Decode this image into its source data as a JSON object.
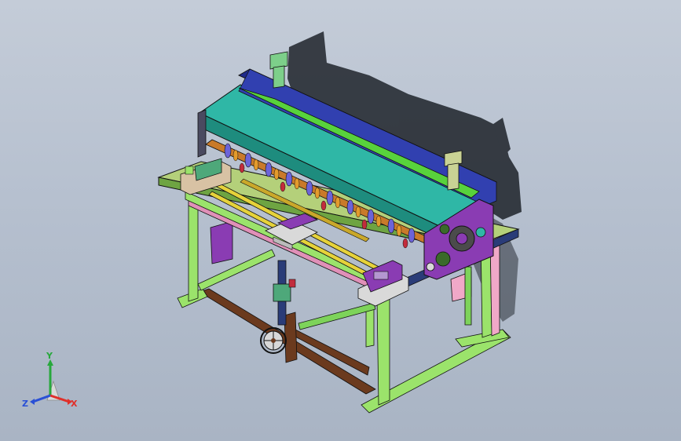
{
  "viewport": {
    "background_top": "#c4ccd8",
    "background_bottom": "#a9b4c4"
  },
  "model": {
    "subject": "slitting-machine-assembly",
    "colors": {
      "frame_leg": "#9be36b",
      "frame_leg_alt": "#f0a8c8",
      "base_beam": "#6b3a1e",
      "top_cover": "#2fb7a6",
      "side_plate": "#8a3cb3",
      "top_rail": "#1f2a8c",
      "guide_bar": "#e6d23a",
      "tray": "#d9d9d9",
      "shadow": "#1e232a",
      "shaft": "#7dd35a"
    }
  },
  "triad": {
    "x_label": "X",
    "y_label": "Y",
    "z_label": "Z",
    "x_color": "#e0302a",
    "y_color": "#27a83c",
    "z_color": "#2a50d6"
  }
}
